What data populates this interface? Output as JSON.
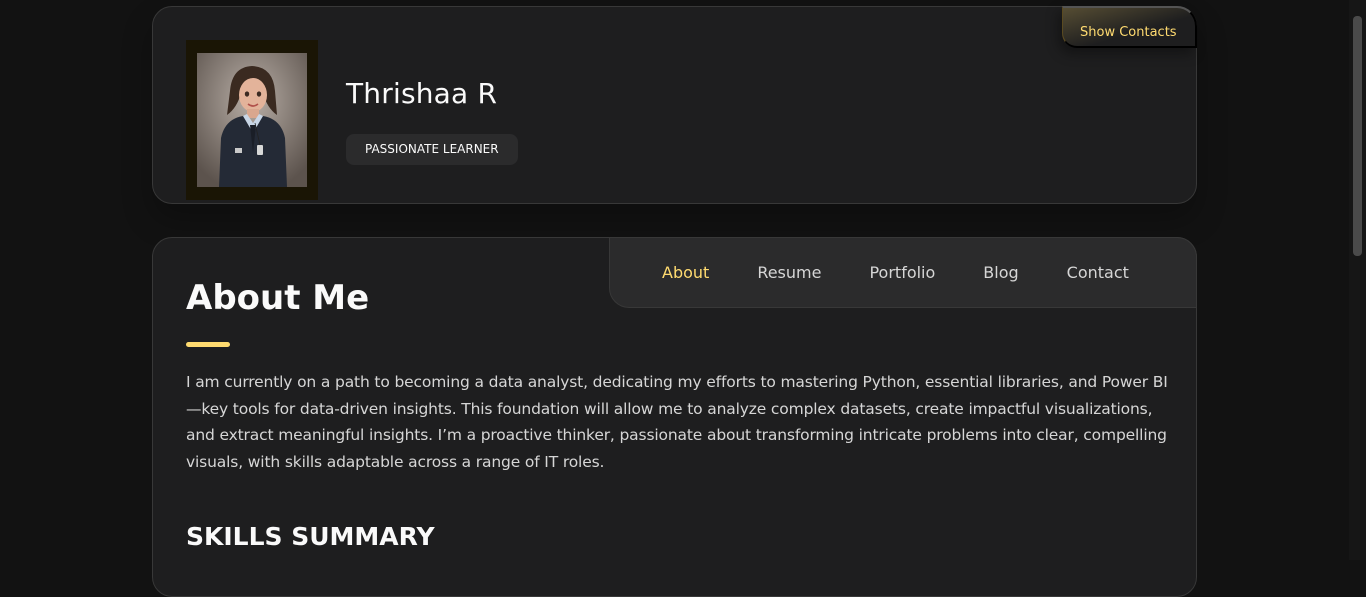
{
  "sidebar": {
    "name": "Thrishaa R",
    "title": "PASSIONATE LEARNER",
    "show_contacts_label": "Show Contacts",
    "accent_color": "#ffdb70"
  },
  "navbar": {
    "links": [
      "About",
      "Resume",
      "Portfolio",
      "Blog",
      "Contact"
    ],
    "active": "About"
  },
  "about": {
    "title": "About Me",
    "paragraph": "I am currently on a path to becoming a data analyst, dedicating my efforts to mastering Python, essential libraries, and Power BI—key tools for data-driven insights. This foundation will allow me to analyze complex datasets, create impactful visualizations, and extract meaningful insights. I’m a proactive thinker, passionate about transforming intricate problems into clear, compelling visuals, with skills adaptable across a range of IT roles.",
    "skills_heading": "SKILLS SUMMARY"
  }
}
